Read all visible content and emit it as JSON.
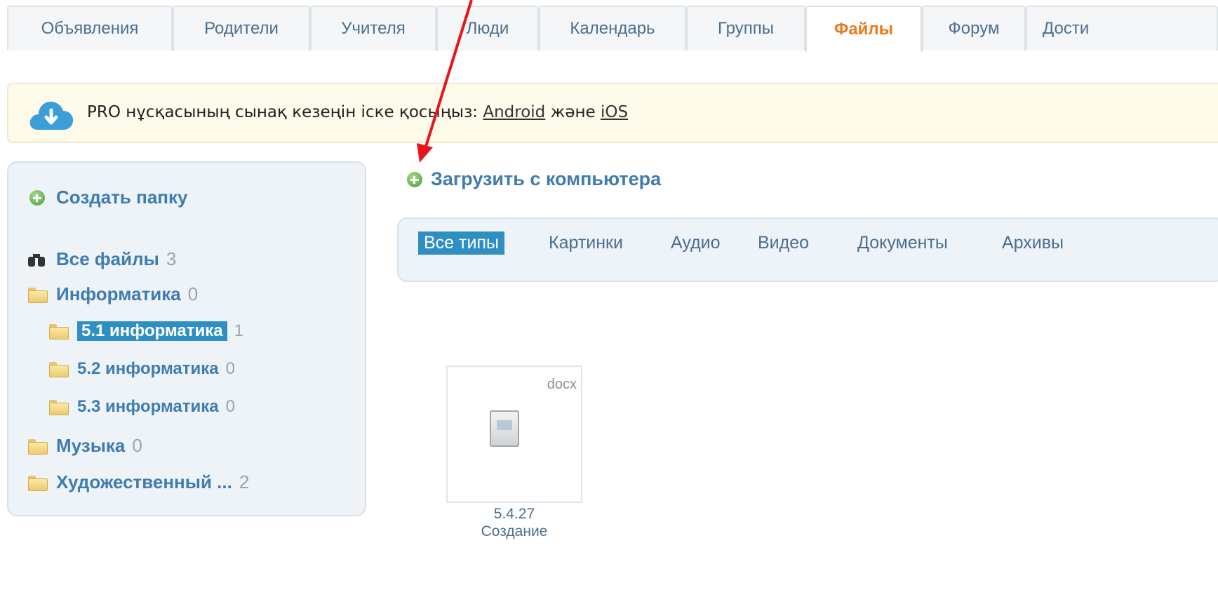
{
  "tabs": [
    {
      "label": "Объявления",
      "active": false
    },
    {
      "label": "Родители",
      "active": false
    },
    {
      "label": "Учителя",
      "active": false
    },
    {
      "label": "Люди",
      "active": false
    },
    {
      "label": "Календарь",
      "active": false
    },
    {
      "label": "Группы",
      "active": false
    },
    {
      "label": "Файлы",
      "active": true
    },
    {
      "label": "Форум",
      "active": false
    },
    {
      "label": "Дости",
      "active": false
    }
  ],
  "banner": {
    "text": "PRO нұсқасының сынақ кезеңін іске қосыңыз:",
    "android_link": "Android",
    "and_text": "және",
    "ios_link": "iOS",
    "icon": "cloud-download-icon"
  },
  "sidebar": {
    "create_folder": "Создать папку",
    "all_files": {
      "label": "Все файлы",
      "count": "3"
    },
    "folders": [
      {
        "label": "Информатика",
        "count": "0",
        "level": 0
      },
      {
        "label": "5.1 информатика",
        "count": "1",
        "level": 1,
        "selected": true
      },
      {
        "label": "5.2 информатика",
        "count": "0",
        "level": 1
      },
      {
        "label": "5.3 информатика",
        "count": "0",
        "level": 1
      },
      {
        "label": "Музыка",
        "count": "0",
        "level": 0
      },
      {
        "label": "Художественный ...",
        "count": "2",
        "level": 0
      }
    ]
  },
  "upload_label": "Загрузить с компьютера",
  "filters": [
    {
      "label": "Все типы",
      "active": true
    },
    {
      "label": "Картинки",
      "active": false
    },
    {
      "label": "Аудио",
      "active": false
    },
    {
      "label": "Видео",
      "active": false
    },
    {
      "label": "Документы",
      "active": false
    },
    {
      "label": "Архивы",
      "active": false
    }
  ],
  "file": {
    "ext": "docx",
    "name_line1": "5.4.27",
    "name_line2": "Создание",
    "icon": "document-icon"
  },
  "colors": {
    "accent": "#2f8fc4",
    "link": "#3f7cb0",
    "active_tab": "#ee7a1c",
    "annotation": "#e8141c"
  }
}
